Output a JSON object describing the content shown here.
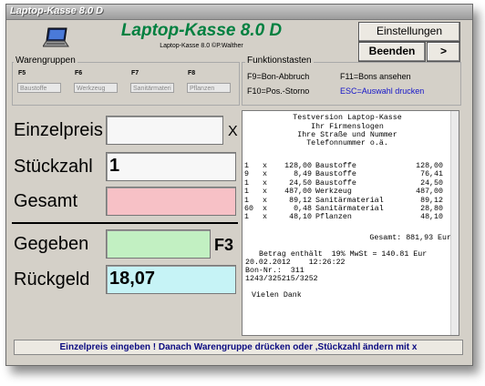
{
  "window": {
    "title": "Laptop-Kasse 8.0 D"
  },
  "header": {
    "app_title": "Laptop-Kasse 8.0 D",
    "subtitle": "Laptop-Kasse 8.0 ©P.Walther"
  },
  "buttons": {
    "settings": "Einstellungen",
    "quit": "Beenden",
    "next": ">"
  },
  "warengruppen": {
    "title": "Warengruppen",
    "items": [
      {
        "key": "F5",
        "name": "Baustoffe"
      },
      {
        "key": "F6",
        "name": "Werkzeug"
      },
      {
        "key": "F7",
        "name": "Sanitärmateri"
      },
      {
        "key": "F8",
        "name": "Pflanzen"
      }
    ]
  },
  "funktionstasten": {
    "title": "Funktionstasten",
    "f9": "F9=Bon-Abbruch",
    "f11": "F11=Bons ansehen",
    "f10": "F10=Pos.-Storno",
    "esc": "ESC=Auswahl drucken"
  },
  "entry": {
    "einzelpreis_label": "Einzelpreis",
    "einzelpreis_value": "",
    "x_label": "X",
    "stueckzahl_label": "Stückzahl",
    "stueckzahl_value": "1",
    "gesamt_label": "Gesamt",
    "gesamt_value": "",
    "gegeben_label": "Gegeben",
    "gegeben_value": "",
    "f3_label": "F3",
    "rueckgeld_label": "Rückgeld",
    "rueckgeld_value": "18,07"
  },
  "receipt": {
    "header_lines": [
      "Testversion Laptop-Kasse",
      "Ihr Firmenslogen",
      "Ihre Straße und Nummer",
      "Telefonnummer o.ä."
    ],
    "items": [
      {
        "qty": "1",
        "price": "128,00",
        "name": "Baustoffe",
        "total": "128,00"
      },
      {
        "qty": "9",
        "price": "8,49",
        "name": "Baustoffe",
        "total": "76,41"
      },
      {
        "qty": "1",
        "price": "24,50",
        "name": "Baustoffe",
        "total": "24,50"
      },
      {
        "qty": "1",
        "price": "487,00",
        "name": "Werkzeug",
        "total": "487,00"
      },
      {
        "qty": "1",
        "price": "89,12",
        "name": "Sanitärmaterial",
        "total": "89,12"
      },
      {
        "qty": "60",
        "price": "0,48",
        "name": "Sanitärmaterial",
        "total": "28,80"
      },
      {
        "qty": "1",
        "price": "48,10",
        "name": "Pflanzen",
        "total": "48,10"
      }
    ],
    "total_line": "Gesamt: 881,93 Eur",
    "vat_line": "Betrag enthält  19% MwSt = 140.81 Eur",
    "datetime_line": "20.02.2012    12:26:22",
    "bon_line": "Bon-Nr.:  311",
    "code_line": "1243/325215/3252",
    "footer_line": "Vielen Dank"
  },
  "status_bar": "Einzelpreis eingeben ! Danach Warengruppe drücken oder ,Stückzahl ändern mit x",
  "colors": {
    "title_green": "#008040",
    "gesamt_pink": "#f7c1c6",
    "gegeben_green": "#c2f0c2",
    "rueckgeld_cyan": "#c6f3f6",
    "status_blue": "#0a0a80"
  }
}
